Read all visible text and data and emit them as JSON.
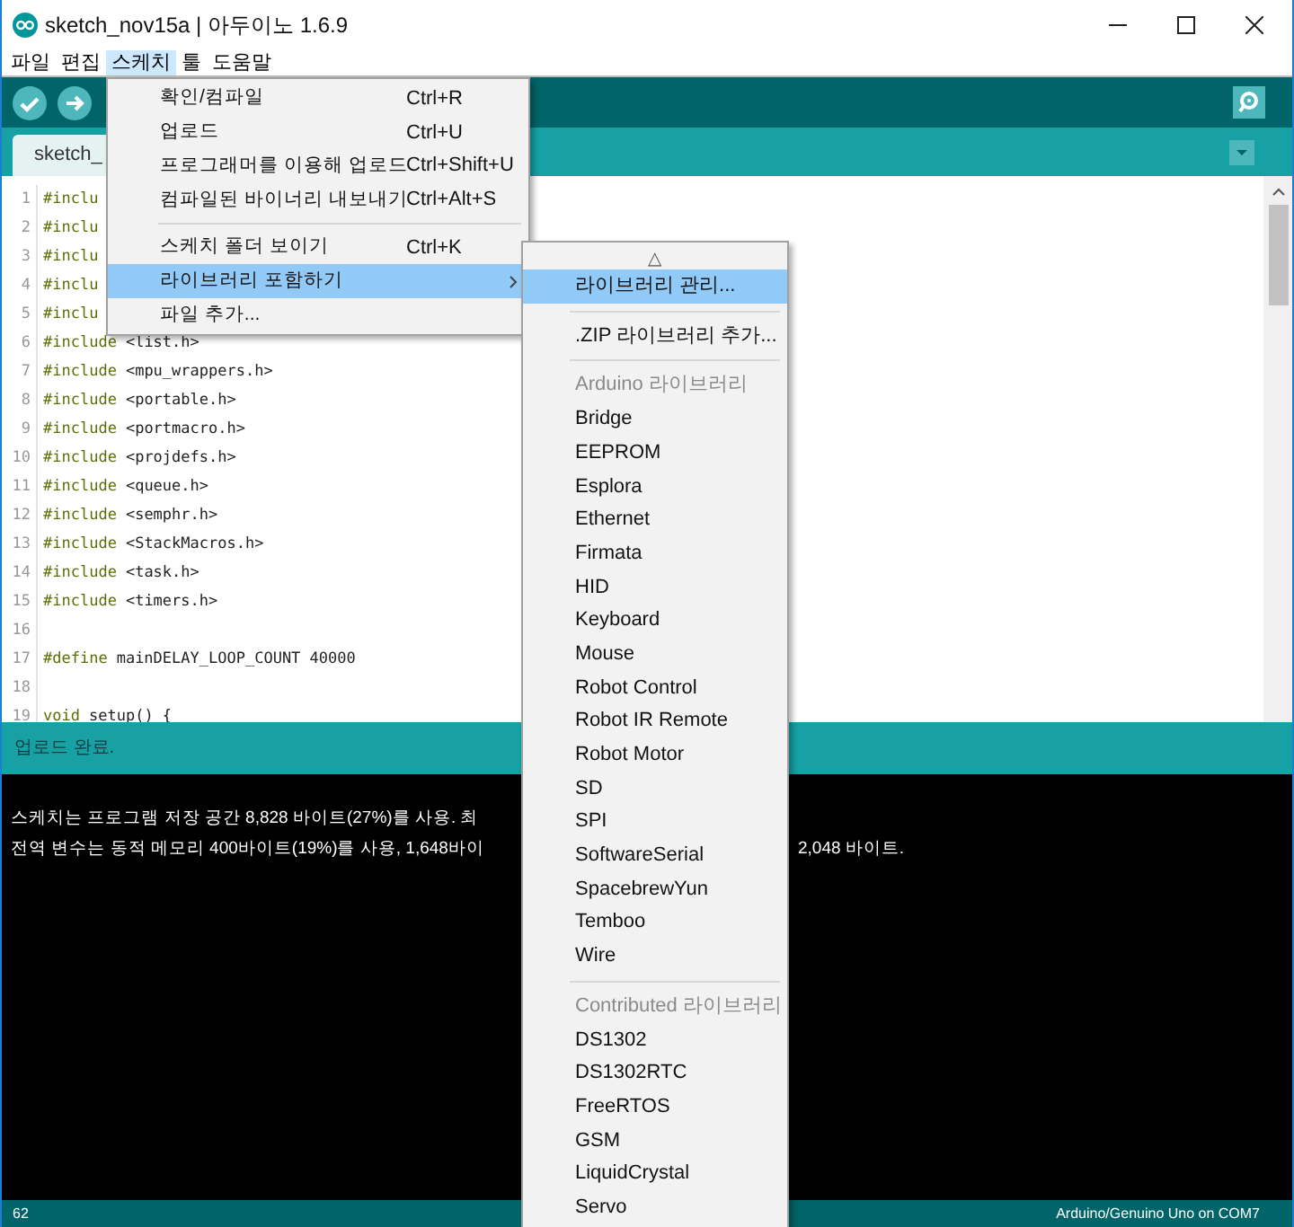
{
  "window": {
    "title": "sketch_nov15a | 아두이노 1.6.9"
  },
  "menubar": [
    {
      "label": "파일",
      "selected": false
    },
    {
      "label": "편집",
      "selected": false
    },
    {
      "label": "스케치",
      "selected": true
    },
    {
      "label": "툴",
      "selected": false
    },
    {
      "label": "도움말",
      "selected": false
    }
  ],
  "menu": [
    {
      "kind": "item",
      "label": "확인/컴파일",
      "shortcut": "Ctrl+R",
      "selected": false
    },
    {
      "kind": "item",
      "label": "업로드",
      "shortcut": "Ctrl+U",
      "selected": false
    },
    {
      "kind": "item",
      "label": "프로그래머를 이용해 업로드",
      "shortcut": "Ctrl+Shift+U",
      "selected": false
    },
    {
      "kind": "item",
      "label": "컴파일된 바이너리 내보내기",
      "shortcut": "Ctrl+Alt+S",
      "selected": false
    },
    {
      "kind": "separator"
    },
    {
      "kind": "item",
      "label": "스케치 폴더 보이기",
      "shortcut": "Ctrl+K",
      "selected": false
    },
    {
      "kind": "submenu",
      "label": "라이브러리 포함하기",
      "selected": true
    },
    {
      "kind": "item",
      "label": "파일 추가...",
      "selected": false
    }
  ],
  "submenu": [
    {
      "kind": "scroll",
      "label": "△"
    },
    {
      "kind": "item",
      "label": "라이브러리 관리...",
      "selected": true
    },
    {
      "kind": "separator"
    },
    {
      "kind": "item",
      "label": ".ZIP 라이브러리 추가...",
      "selected": false
    },
    {
      "kind": "separator"
    },
    {
      "kind": "header",
      "label": "Arduino 라이브러리"
    },
    {
      "kind": "item",
      "label": "Bridge",
      "selected": false
    },
    {
      "kind": "item",
      "label": "EEPROM",
      "selected": false
    },
    {
      "kind": "item",
      "label": "Esplora",
      "selected": false
    },
    {
      "kind": "item",
      "label": "Ethernet",
      "selected": false
    },
    {
      "kind": "item",
      "label": "Firmata",
      "selected": false
    },
    {
      "kind": "item",
      "label": "HID",
      "selected": false
    },
    {
      "kind": "item",
      "label": "Keyboard",
      "selected": false
    },
    {
      "kind": "item",
      "label": "Mouse",
      "selected": false
    },
    {
      "kind": "item",
      "label": "Robot Control",
      "selected": false
    },
    {
      "kind": "item",
      "label": "Robot IR Remote",
      "selected": false
    },
    {
      "kind": "item",
      "label": "Robot Motor",
      "selected": false
    },
    {
      "kind": "item",
      "label": "SD",
      "selected": false
    },
    {
      "kind": "item",
      "label": "SPI",
      "selected": false
    },
    {
      "kind": "item",
      "label": "SoftwareSerial",
      "selected": false
    },
    {
      "kind": "item",
      "label": "SpacebrewYun",
      "selected": false
    },
    {
      "kind": "item",
      "label": "Temboo",
      "selected": false
    },
    {
      "kind": "item",
      "label": "Wire",
      "selected": false
    },
    {
      "kind": "separator"
    },
    {
      "kind": "header",
      "label": "Contributed 라이브러리"
    },
    {
      "kind": "item",
      "label": "DS1302",
      "selected": false
    },
    {
      "kind": "item",
      "label": "DS1302RTC",
      "selected": false
    },
    {
      "kind": "item",
      "label": "FreeRTOS",
      "selected": false
    },
    {
      "kind": "item",
      "label": "GSM",
      "selected": false
    },
    {
      "kind": "item",
      "label": "LiquidCrystal",
      "selected": false
    },
    {
      "kind": "item",
      "label": "Servo",
      "selected": false
    }
  ],
  "tab": {
    "label": "sketch_"
  },
  "editor": {
    "lines": [
      {
        "number": "1",
        "keyword": "#inclu"
      },
      {
        "number": "2",
        "keyword": "#inclu"
      },
      {
        "number": "3",
        "keyword": "#inclu"
      },
      {
        "number": "4",
        "keyword": "#inclu"
      },
      {
        "number": "5",
        "keyword": "#inclu"
      },
      {
        "number": "6",
        "keyword": "#include",
        "text": "<list.h>"
      },
      {
        "number": "7",
        "keyword": "#include",
        "text": "<mpu_wrappers.h>"
      },
      {
        "number": "8",
        "keyword": "#include",
        "text": "<portable.h>"
      },
      {
        "number": "9",
        "keyword": "#include",
        "text": "<portmacro.h>"
      },
      {
        "number": "10",
        "keyword": "#include",
        "text": "<projdefs.h>"
      },
      {
        "number": "11",
        "keyword": "#include",
        "text": "<queue.h>"
      },
      {
        "number": "12",
        "keyword": "#include",
        "text": "<semphr.h>"
      },
      {
        "number": "13",
        "keyword": "#include",
        "text": "<StackMacros.h>"
      },
      {
        "number": "14",
        "keyword": "#include",
        "text": "<task.h>"
      },
      {
        "number": "15",
        "keyword": "#include",
        "text": "<timers.h>"
      },
      {
        "number": "16"
      },
      {
        "number": "17",
        "keyword": "#define",
        "text": "mainDELAY_LOOP_COUNT 40000"
      },
      {
        "number": "18"
      },
      {
        "number": "19",
        "keyword": "void",
        "text": "setup() {"
      }
    ]
  },
  "status": "업로드 완료.",
  "console": {
    "lines": [
      {
        "left": "스케치는 프로그램 저장 공간 8,828 바이트(27%)를 사용. 최"
      },
      {
        "left": "전역 변수는 동적 메모리 400바이트(19%)를 사용, 1,648바이",
        "right": "2,048 바이트."
      }
    ]
  },
  "status_bar": {
    "line": "62",
    "board": "Arduino/Genuino Uno on COM7"
  }
}
